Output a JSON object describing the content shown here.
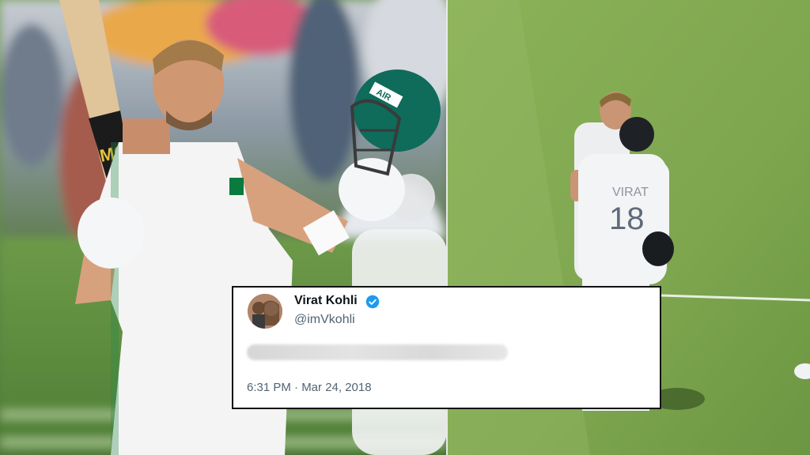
{
  "tweet": {
    "display_name": "Virat Kohli",
    "handle": "@imVkohli",
    "body_text_blurred": true,
    "timestamp": "6:31 PM · Mar 24, 2018",
    "verified_color": "#1d9bf0"
  },
  "left_photo": {
    "helmet_text": "AIR",
    "bat_brand": "MG"
  },
  "right_photo": {
    "jersey_name": "VIRAT",
    "jersey_number": "18"
  }
}
